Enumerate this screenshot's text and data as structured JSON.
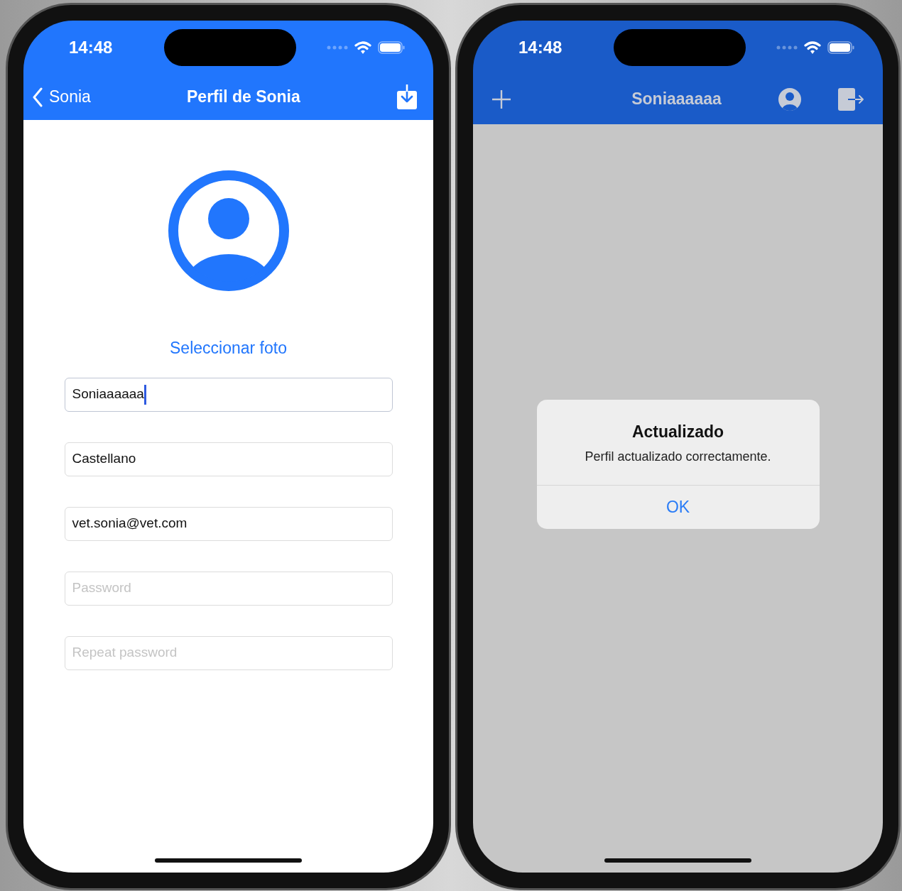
{
  "screens": [
    {
      "kind": "profile_form",
      "status_bar": {
        "time": "14:48"
      },
      "nav_bar": {
        "back_label": "Sonia",
        "title": "Perfil de Sonia"
      },
      "select_photo": "Seleccionar foto",
      "fields": [
        {
          "value": "Soniaaaaaa",
          "focused": true
        },
        {
          "value": "Castellano",
          "focused": false
        },
        {
          "value": "vet.sonia@vet.com",
          "focused": false
        },
        {
          "placeholder": "Password",
          "focused": false
        },
        {
          "placeholder": "Repeat password",
          "focused": false
        }
      ]
    },
    {
      "kind": "alert_over_home",
      "status_bar": {
        "time": "14:48"
      },
      "nav_bar": {
        "title": "Soniaaaaaa"
      },
      "alert": {
        "title": "Actualizado",
        "message": "Perfil actualizado correctamente.",
        "button": "OK"
      }
    }
  ]
}
